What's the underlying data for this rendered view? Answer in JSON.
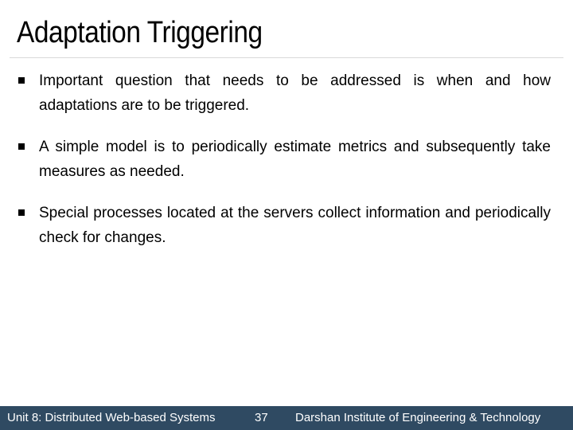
{
  "slide": {
    "title": "Adaptation Triggering",
    "bullets": [
      "Important question that needs to be addressed is when and how adaptations are to be triggered.",
      "A simple model is to periodically estimate metrics and subsequently take measures as needed.",
      "Special processes located at the servers collect information and periodically check for changes."
    ]
  },
  "footer": {
    "unit": "Unit 8: Distributed Web-based Systems",
    "page_number": "37",
    "institute": "Darshan Institute of Engineering & Technology"
  },
  "colors": {
    "footer_background": "#2f4a62",
    "footer_text": "#ffffff",
    "divider": "#d9d9d9"
  }
}
